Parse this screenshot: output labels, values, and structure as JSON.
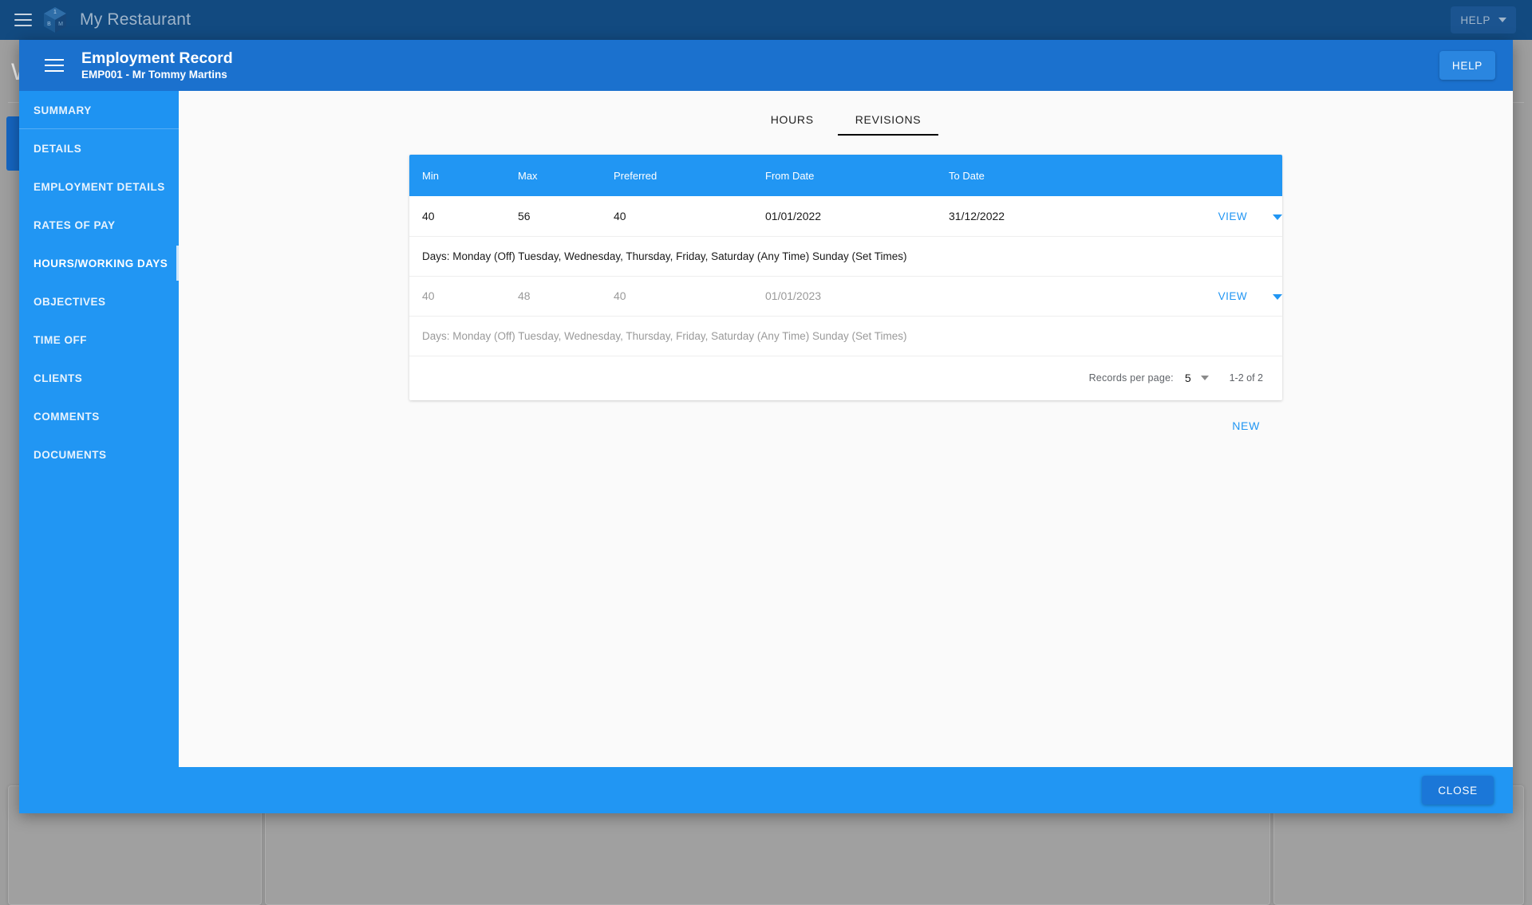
{
  "appbar": {
    "menu_icon": "hamburger-icon",
    "logo_icon": "cube-logo-icon",
    "logo_letters": {
      "top": "1",
      "left": "B",
      "right": "M"
    },
    "title": "My Restaurant",
    "help_label": "HELP",
    "caret_icon": "chevron-down-icon"
  },
  "background": {
    "letter": "W"
  },
  "modal": {
    "menu_icon": "hamburger-icon",
    "title": "Employment Record",
    "subtitle": "EMP001 - Mr Tommy Martins",
    "help_label": "HELP",
    "close_label": "CLOSE"
  },
  "sidebar": {
    "items": [
      {
        "label": "SUMMARY",
        "name": "summary"
      },
      {
        "label": "DETAILS",
        "name": "details"
      },
      {
        "label": "EMPLOYMENT DETAILS",
        "name": "employment-details"
      },
      {
        "label": "RATES OF PAY",
        "name": "rates-of-pay"
      },
      {
        "label": "HOURS/WORKING DAYS",
        "name": "hours-working-days"
      },
      {
        "label": "OBJECTIVES",
        "name": "objectives"
      },
      {
        "label": "TIME OFF",
        "name": "time-off"
      },
      {
        "label": "CLIENTS",
        "name": "clients"
      },
      {
        "label": "COMMENTS",
        "name": "comments"
      },
      {
        "label": "DOCUMENTS",
        "name": "documents"
      }
    ],
    "active_index": 4
  },
  "tabs": [
    {
      "label": "HOURS",
      "name": "hours"
    },
    {
      "label": "REVISIONS",
      "name": "revisions"
    }
  ],
  "active_tab_index": 1,
  "table": {
    "headers": [
      "Min",
      "Max",
      "Preferred",
      "From Date",
      "To Date"
    ],
    "rows": [
      {
        "min": "40",
        "max": "56",
        "preferred": "40",
        "from_date": "01/01/2022",
        "to_date": "31/12/2022",
        "action_label": "VIEW",
        "expand_icon": "caret-down-icon",
        "detail": "Days: Monday (Off) Tuesday, Wednesday, Thursday, Friday, Saturday (Any Time) Sunday (Set Times)"
      },
      {
        "min": "40",
        "max": "48",
        "preferred": "40",
        "from_date": "01/01/2023",
        "to_date": "",
        "action_label": "VIEW",
        "expand_icon": "caret-down-icon",
        "detail": "Days: Monday (Off) Tuesday, Wednesday, Thursday, Friday, Saturday (Any Time) Sunday (Set Times)"
      }
    ]
  },
  "pagination": {
    "records_per_page_label": "Records per page:",
    "records_per_page_value": "5",
    "select_caret_icon": "chevron-down-icon",
    "range_label": "1-2 of 2"
  },
  "actions": {
    "new_label": "NEW"
  },
  "colors": {
    "appbar": "#124A80",
    "modal_header": "#1B71CE",
    "sidebar": "#2196F3",
    "table_header": "#2196F3",
    "accent_link": "#2196F3",
    "footer": "#2196F3",
    "page_background": "#9E9E9E"
  }
}
